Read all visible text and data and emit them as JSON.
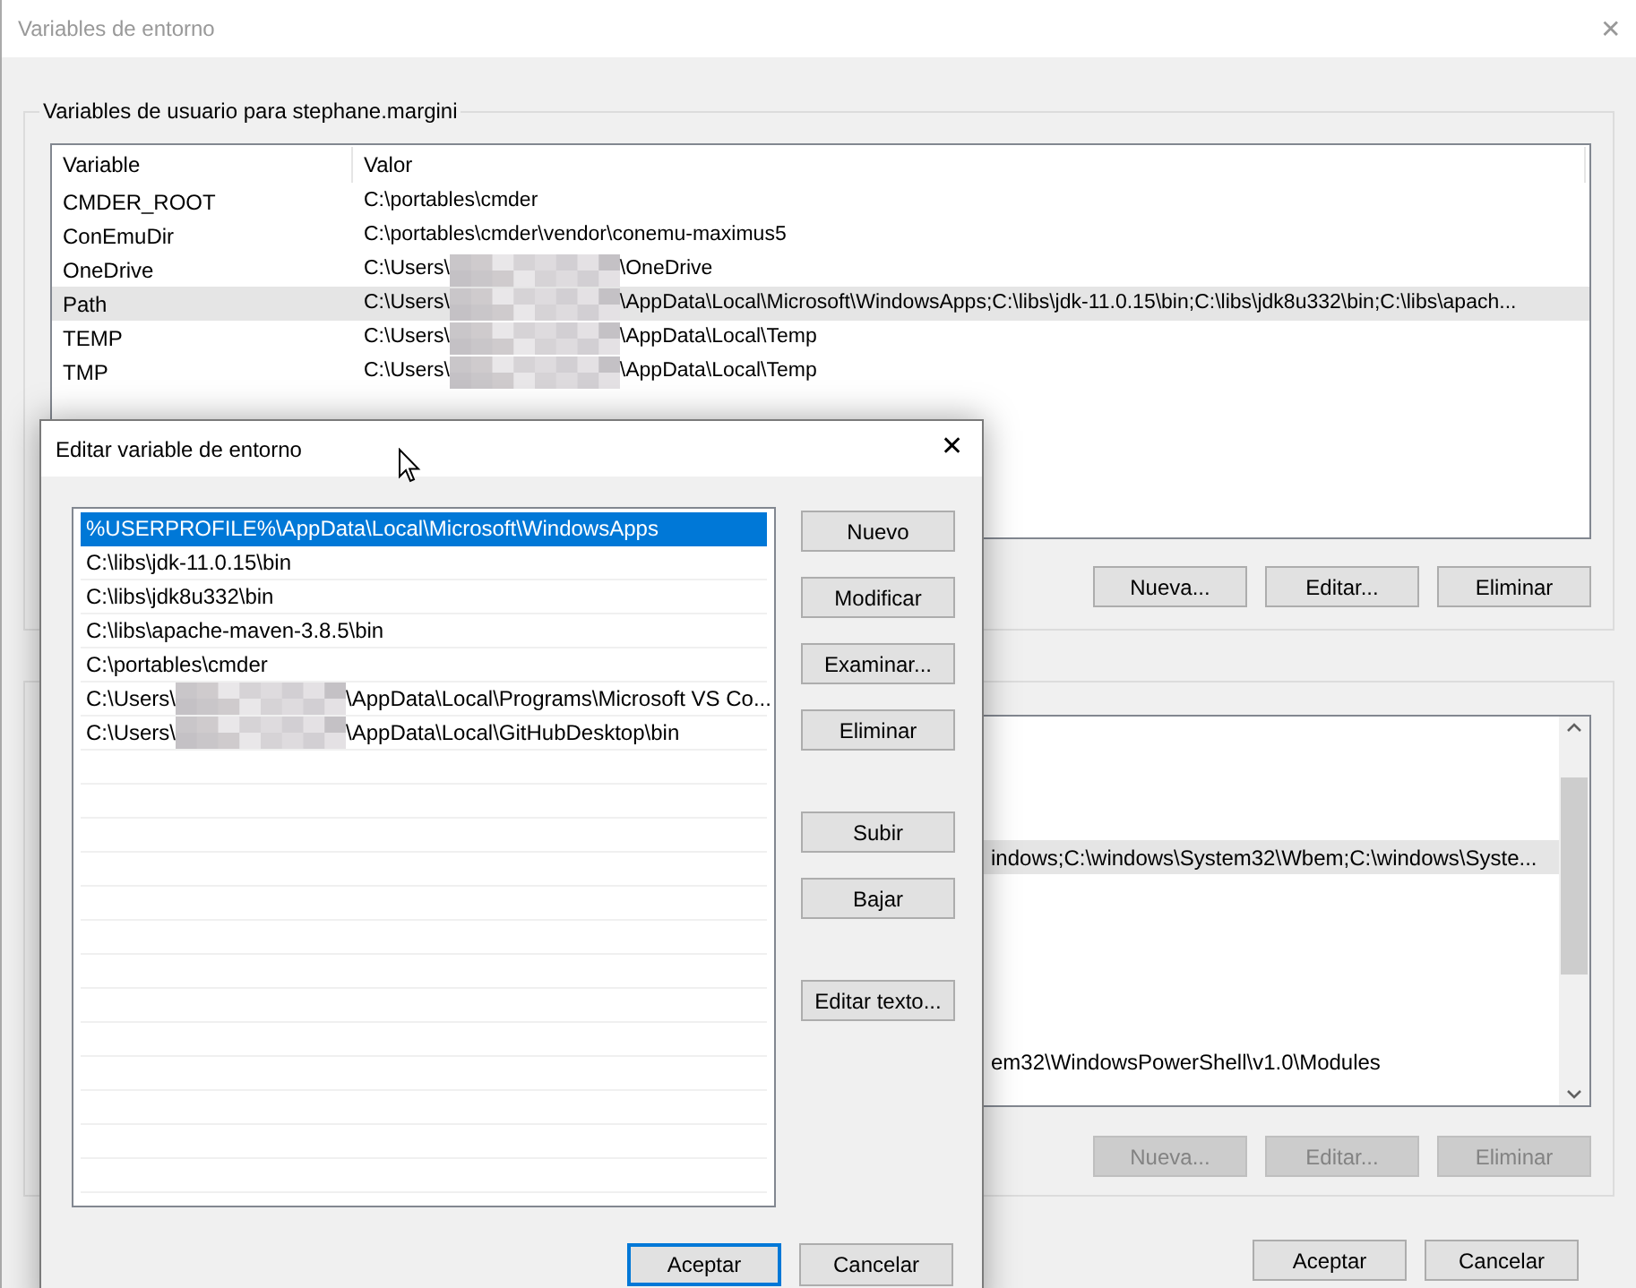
{
  "window": {
    "title": "Variables de entorno",
    "close": "✕"
  },
  "user_group": {
    "title": "Variables de usuario para stephane.margini",
    "columns": [
      "Variable",
      "Valor"
    ],
    "rows": [
      {
        "variable": "CMDER_ROOT",
        "value": "C:\\portables\\cmder",
        "redacted": false,
        "selected": false
      },
      {
        "variable": "ConEmuDir",
        "value": "C:\\portables\\cmder\\vendor\\conemu-maximus5",
        "redacted": false,
        "selected": false
      },
      {
        "variable": "OneDrive",
        "value": "C:\\Users\\",
        "value_after": "\\OneDrive",
        "redacted": true,
        "selected": false
      },
      {
        "variable": "Path",
        "value": "C:\\Users\\",
        "value_after": "\\AppData\\Local\\Microsoft\\WindowsApps;C:\\libs\\jdk-11.0.15\\bin;C:\\libs\\jdk8u332\\bin;C:\\libs\\apach...",
        "redacted": true,
        "selected": true
      },
      {
        "variable": "TEMP",
        "value": "C:\\Users\\",
        "value_after": "\\AppData\\Local\\Temp",
        "redacted": true,
        "selected": false
      },
      {
        "variable": "TMP",
        "value": "C:\\Users\\",
        "value_after": "\\AppData\\Local\\Temp",
        "redacted": true,
        "selected": false
      }
    ],
    "buttons": [
      {
        "label": "Nueva...",
        "disabled": false
      },
      {
        "label": "Editar...",
        "disabled": false
      },
      {
        "label": "Eliminar",
        "disabled": false
      }
    ]
  },
  "system_group": {
    "rows": [
      {
        "selected": false
      },
      {
        "selected": false
      },
      {
        "selected": false
      },
      {
        "value": "indows;C:\\windows\\System32\\Wbem;C:\\windows\\Syste...",
        "selected": true
      },
      {
        "selected": false
      },
      {
        "selected": false
      },
      {
        "selected": false
      },
      {
        "selected": false
      },
      {
        "selected": false
      },
      {
        "value": "em32\\WindowsPowerShell\\v1.0\\Modules",
        "selected": false
      }
    ],
    "buttons": [
      {
        "label": "Nueva...",
        "disabled": true
      },
      {
        "label": "Editar...",
        "disabled": true
      },
      {
        "label": "Eliminar",
        "disabled": true
      }
    ]
  },
  "footer_buttons": [
    {
      "label": "Aceptar"
    },
    {
      "label": "Cancelar"
    }
  ],
  "dialog": {
    "title": "Editar variable de entorno",
    "close": "✕",
    "entries": [
      {
        "value": "%USERPROFILE%\\AppData\\Local\\Microsoft\\WindowsApps",
        "redacted": false,
        "selected": true
      },
      {
        "value": "C:\\libs\\jdk-11.0.15\\bin",
        "redacted": false,
        "selected": false
      },
      {
        "value": "C:\\libs\\jdk8u332\\bin",
        "redacted": false,
        "selected": false
      },
      {
        "value": "C:\\libs\\apache-maven-3.8.5\\bin",
        "redacted": false,
        "selected": false
      },
      {
        "value": "C:\\portables\\cmder",
        "redacted": false,
        "selected": false
      },
      {
        "value": "C:\\Users\\",
        "value_after": "\\AppData\\Local\\Programs\\Microsoft VS Co...",
        "redacted": true,
        "selected": false
      },
      {
        "value": "C:\\Users\\",
        "value_after": "\\AppData\\Local\\GitHubDesktop\\bin",
        "redacted": true,
        "selected": false
      }
    ],
    "side_button_groups": [
      [
        {
          "label": "Nuevo"
        },
        {
          "label": "Modificar"
        },
        {
          "label": "Examinar..."
        },
        {
          "label": "Eliminar"
        }
      ],
      [
        {
          "label": "Subir"
        },
        {
          "label": "Bajar"
        }
      ],
      [
        {
          "label": "Editar texto..."
        }
      ]
    ],
    "footer_buttons": [
      {
        "label": "Aceptar",
        "default": true
      },
      {
        "label": "Cancelar",
        "default": false
      }
    ]
  }
}
